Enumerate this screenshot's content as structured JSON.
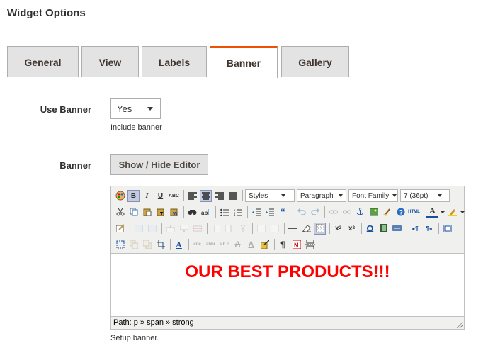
{
  "section_title": "Widget Options",
  "tabs": [
    {
      "label": "General",
      "active": false
    },
    {
      "label": "View",
      "active": false
    },
    {
      "label": "Labels",
      "active": false
    },
    {
      "label": "Banner",
      "active": true
    },
    {
      "label": "Gallery",
      "active": false
    }
  ],
  "use_banner": {
    "label": "Use Banner",
    "value": "Yes",
    "note": "Include banner"
  },
  "banner": {
    "label": "Banner",
    "toggle_button": "Show / Hide Editor",
    "note": "Setup banner."
  },
  "editor": {
    "styles_dropdown": "Styles",
    "format_dropdown": "Paragraph",
    "font_family_dropdown": "Font Family",
    "font_size_dropdown": "7 (36pt)",
    "content_text": "OUR BEST PRODUCTS!!!",
    "content_color": "#ff0000",
    "path": "Path: p » span » strong"
  },
  "colors": {
    "active_tab_accent": "#eb5202",
    "tab_background": "#e3e3e3"
  }
}
